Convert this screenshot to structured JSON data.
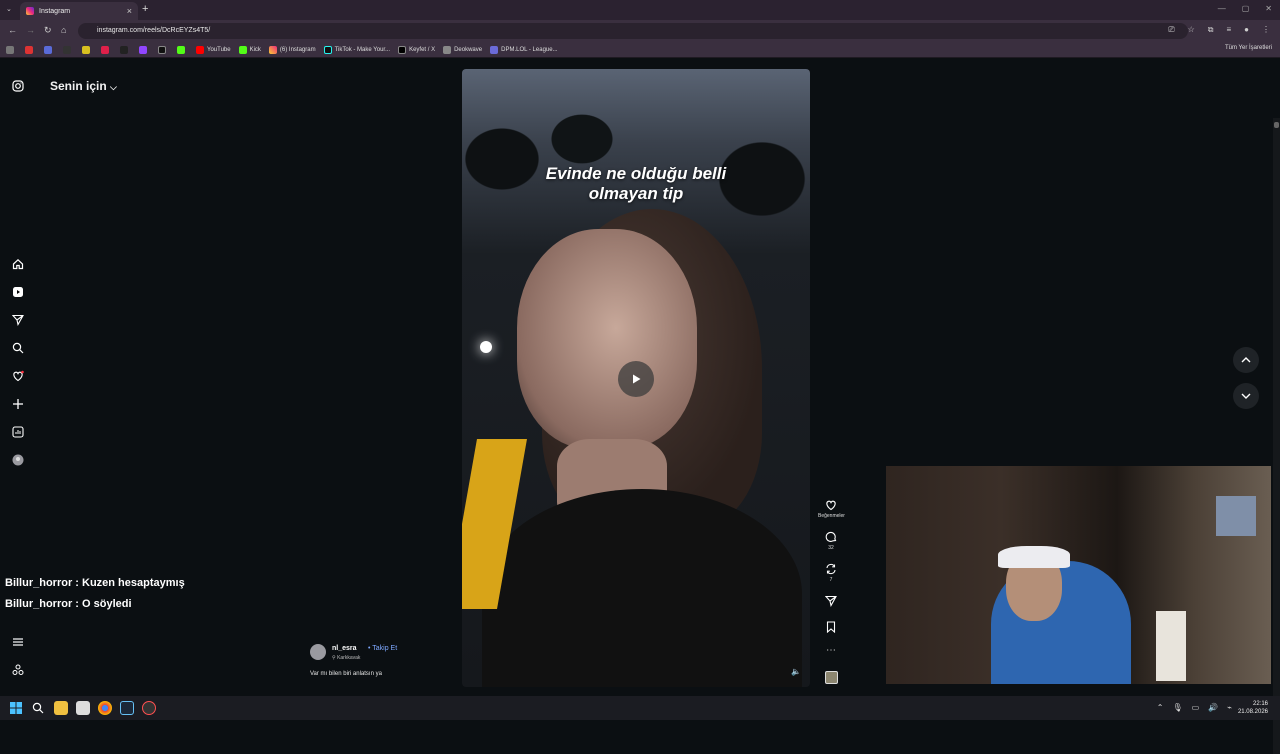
{
  "browser": {
    "tab_title": "Instagram",
    "new_tab": "+",
    "url": "instagram.com/reels/DcRcEYZs4T5/",
    "bookmarks": [
      "YouTube",
      "Kick",
      "(6) Instagram",
      "TikTok - Make Your...",
      "Keyfet / X",
      "Deokwave",
      "DPM.LOL - League..."
    ],
    "all_bookmarks": "Tüm Yer İşaretleri"
  },
  "page": {
    "for_you": "Senin için",
    "caption_line1": "Evinde ne olduğu belli",
    "caption_line2": "olmayan tip",
    "likes_label": "Beğenmeler",
    "comments_count": "32",
    "reposts_count": "7",
    "author": {
      "name": "nl_esra",
      "follow": "• Takip Et",
      "location": "Karkkavak",
      "description": "Var mı bilen biri anlatsın ya"
    },
    "chat": [
      "Billur_horror : Kuzen hesaptaymış",
      "Billur_horror : O söyledi"
    ]
  },
  "taskbar": {
    "time": "22:16",
    "date": "21.08.2026"
  },
  "colors": {
    "accent_follow": "#7ea8ff",
    "page_bg": "#0b0f12",
    "chrome_bg": "#3a2f3f"
  }
}
